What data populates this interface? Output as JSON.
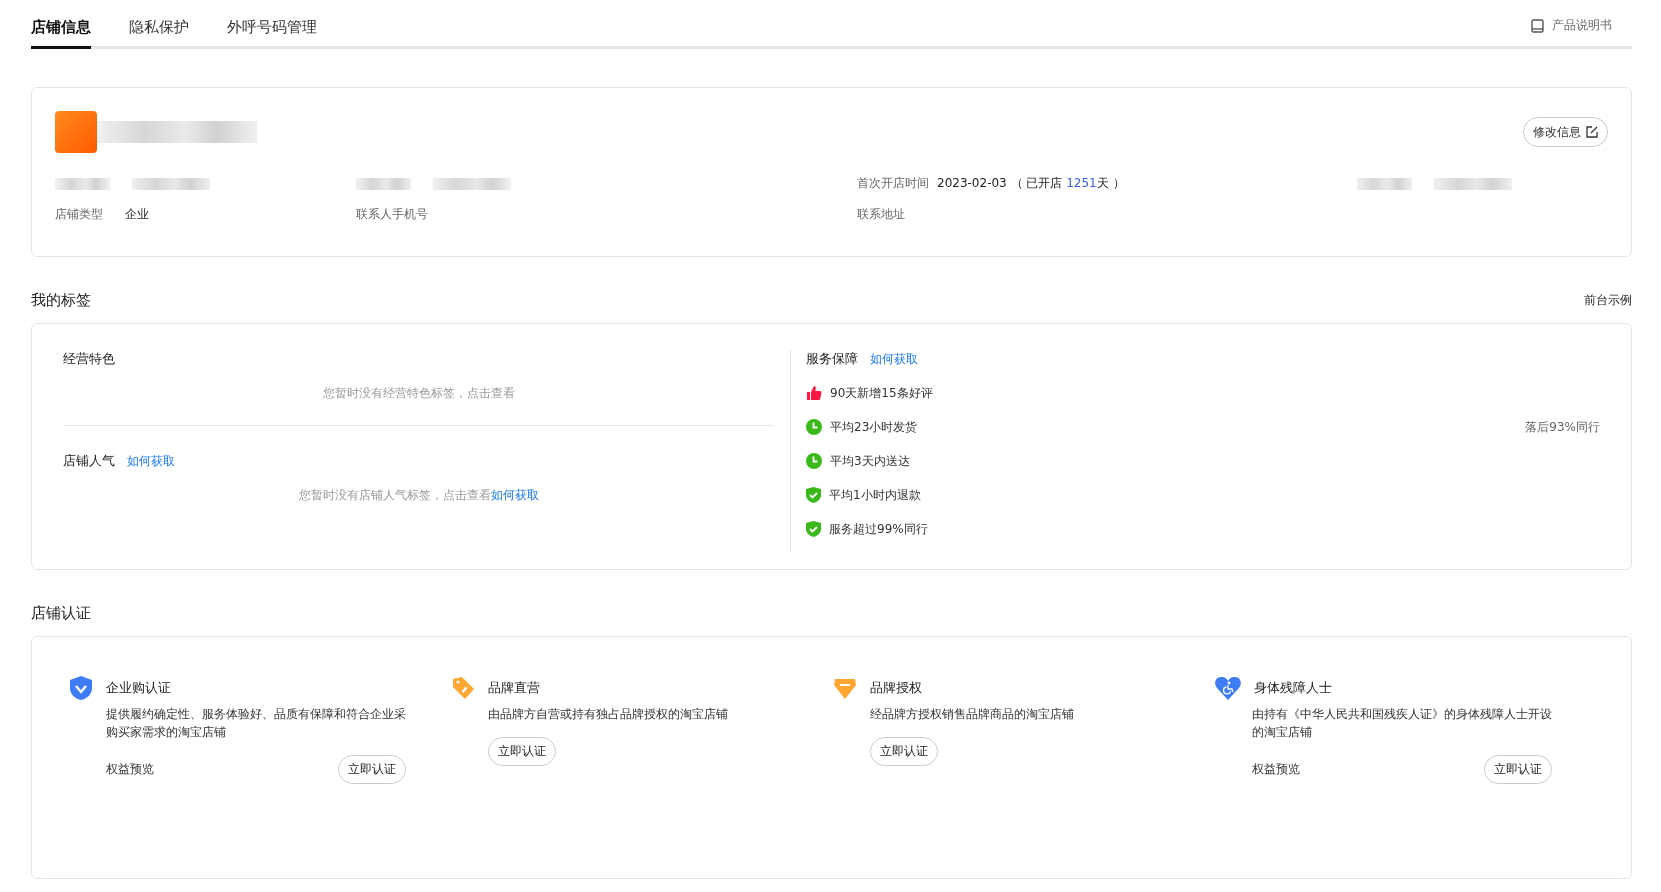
{
  "tabs": [
    {
      "label": "店铺信息",
      "selected": true
    },
    {
      "label": "隐私保护",
      "selected": false
    },
    {
      "label": "外呼号码管理",
      "selected": false
    }
  ],
  "manual_link": "产品说明书",
  "store_info": {
    "edit_button": "修改信息",
    "fields": [
      {
        "kind": "blurred"
      },
      {
        "kind": "blurred"
      },
      {
        "kind": "opened",
        "label": "首次开店时间",
        "date": "2023-02-03",
        "prefix": "（ 已开店 ",
        "days": "1251",
        "suffix": "天 ）"
      },
      {
        "kind": "blurred"
      },
      {
        "kind": "text",
        "label": "店铺类型",
        "value": "企业"
      },
      {
        "kind": "text",
        "label": "联系人手机号"
      },
      {
        "kind": "text",
        "label": "联系地址"
      }
    ]
  },
  "tags": {
    "title": "我的标签",
    "example_link": "前台示例",
    "features": {
      "title": "经营特色",
      "empty_text": "您暂时没有经营特色标签，点击查看"
    },
    "popularity": {
      "title": "店铺人气",
      "link": "如何获取",
      "empty_text": "您暂时没有店铺人气标签，点击查看",
      "empty_link": "如何获取"
    },
    "service": {
      "title": "服务保障",
      "link": "如何获取",
      "items": [
        {
          "kind": "thumb",
          "text": "90天新增15条好评"
        },
        {
          "kind": "clock",
          "text": "平均23小时发货",
          "note": "落后93%同行"
        },
        {
          "kind": "clock",
          "text": "平均3天内送达"
        },
        {
          "kind": "shield",
          "text": "平均1小时内退款"
        },
        {
          "kind": "shield",
          "text": "服务超过99%同行"
        }
      ]
    }
  },
  "certification": {
    "title": "店铺认证",
    "items": [
      {
        "kind": "shield",
        "title": "企业购认证",
        "description": "提供履约确定性、服务体验好、品质有保障和符合企业采购买家需求的淘宝店铺",
        "preview": "权益预览",
        "button": "立即认证"
      },
      {
        "kind": "tag",
        "title": "品牌直营",
        "description": "由品牌方自营或持有独占品牌授权的淘宝店铺",
        "button": "立即认证"
      },
      {
        "kind": "gem",
        "title": "品牌授权",
        "description": "经品牌方授权销售品牌商品的淘宝店铺",
        "button": "立即认证"
      },
      {
        "kind": "heart",
        "title": "身体残障人士",
        "description": "由持有《中华人民共和国残疾人证》的身体残障人士开设的淘宝店铺",
        "preview": "权益预览",
        "button": "立即认证"
      }
    ]
  }
}
